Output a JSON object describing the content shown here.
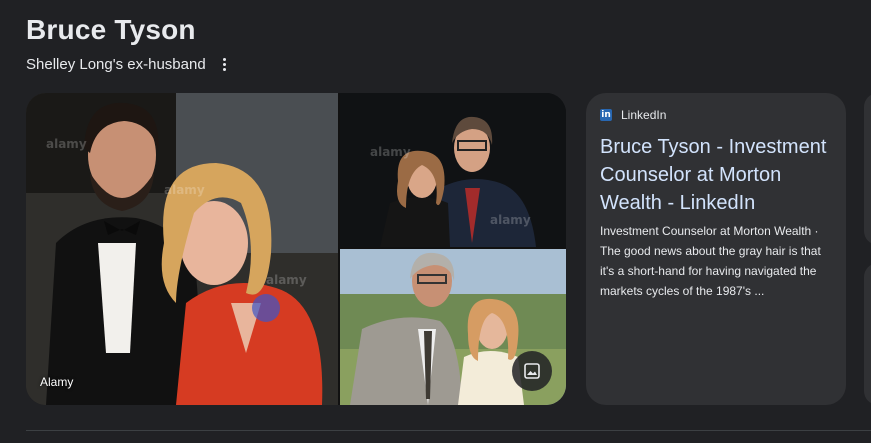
{
  "header": {
    "title": "Bruce Tyson",
    "subtitle": "Shelley Long's ex-husband"
  },
  "gallery": {
    "source_label": "Alamy",
    "watermark": "alamy",
    "button_icon": "image-icon"
  },
  "card": {
    "source": "LinkedIn",
    "logo_text": "in",
    "title": "Bruce Tyson - Investment Counselor at Morton Wealth - LinkedIn",
    "snippet": "Investment Counselor at Morton Wealth · The good news about the gray hair is that it's a short-hand for having navigated the markets cycles of the 1987's ..."
  },
  "colors": {
    "background": "#202124",
    "card": "#303134",
    "link": "#d2e3fc",
    "linkedin": "#2867b2"
  }
}
